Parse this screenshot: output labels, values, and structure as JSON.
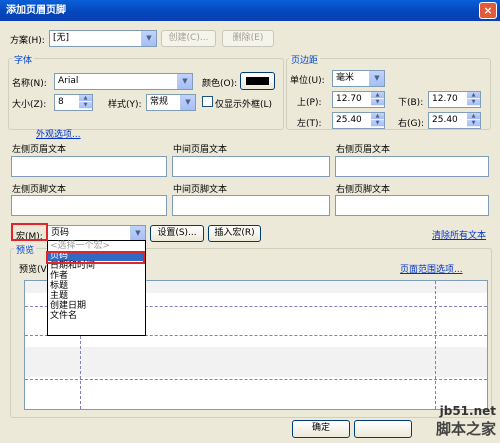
{
  "window": {
    "title": "添加页眉页脚",
    "close_glyph": "×"
  },
  "scheme": {
    "label": "方案(H):",
    "value": "[无]",
    "create_button": "创建(C)...",
    "delete_button": "删除(E)"
  },
  "font_group": {
    "title": "字体",
    "name_label": "名称(N):",
    "name_value": "Arial",
    "color_label": "颜色(O):",
    "color_value": "#000000",
    "size_label": "大小(Z):",
    "size_value": "8",
    "style_label": "样式(Y):",
    "style_value": "常规",
    "outline_only_label": "仅显示外框(L)"
  },
  "margin_group": {
    "title": "页边距",
    "unit_label": "单位(U):",
    "unit_value": "毫米",
    "top_label": "上(P):",
    "top_value": "12.70",
    "bottom_label": "下(B):",
    "bottom_value": "12.70",
    "left_label": "左(T):",
    "left_value": "25.40",
    "right_label": "右(G):",
    "right_value": "25.40"
  },
  "appearance_link": "外观选项...",
  "header": {
    "left": "左侧页眉文本",
    "center": "中间页眉文本",
    "right": "右侧页眉文本"
  },
  "footer": {
    "left": "左侧页脚文本",
    "center": "中间页脚文本",
    "right": "右侧页脚文本"
  },
  "macro": {
    "label": "宏(M):",
    "value": "页码",
    "settings_button": "设置(S)...",
    "insert_button": "插入宏(R)",
    "clear_all_link": "清除所有文本",
    "options": [
      "<选择一个宏>",
      "页码",
      "日期和时间",
      "作者",
      "标题",
      "主题",
      "创建日期",
      "文件名"
    ],
    "selected_index": 1
  },
  "preview": {
    "group_title": "预览",
    "label": "预览(V)",
    "page_range_link": "页面范围选项..."
  },
  "footer_buttons": {
    "ok": "确定"
  },
  "watermark": {
    "site": "jb51.net",
    "brand": "脚本之家"
  }
}
